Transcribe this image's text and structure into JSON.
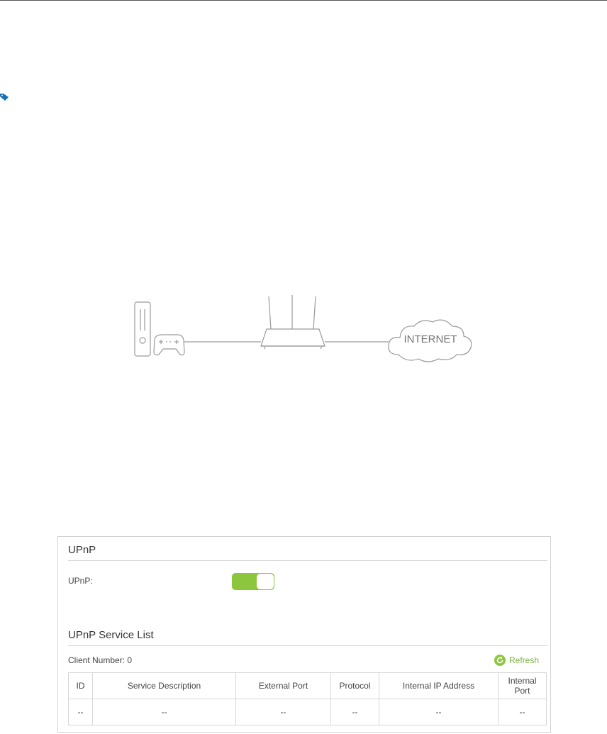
{
  "diagram": {
    "internet_label": "INTERNET"
  },
  "panel": {
    "upnp_title": "UPnP",
    "upnp_label": "UPnP:",
    "upnp_enabled": true,
    "service_list_title": "UPnP Service List",
    "client_number": "Client Number: 0",
    "refresh_label": "Refresh",
    "accent_color": "#8cc63f"
  },
  "table": {
    "headers": [
      "ID",
      "Service Description",
      "External Port",
      "Protocol",
      "Internal IP Address",
      "Internal Port"
    ],
    "rows": [
      [
        "--",
        "--",
        "--",
        "--",
        "--",
        "--"
      ]
    ]
  }
}
